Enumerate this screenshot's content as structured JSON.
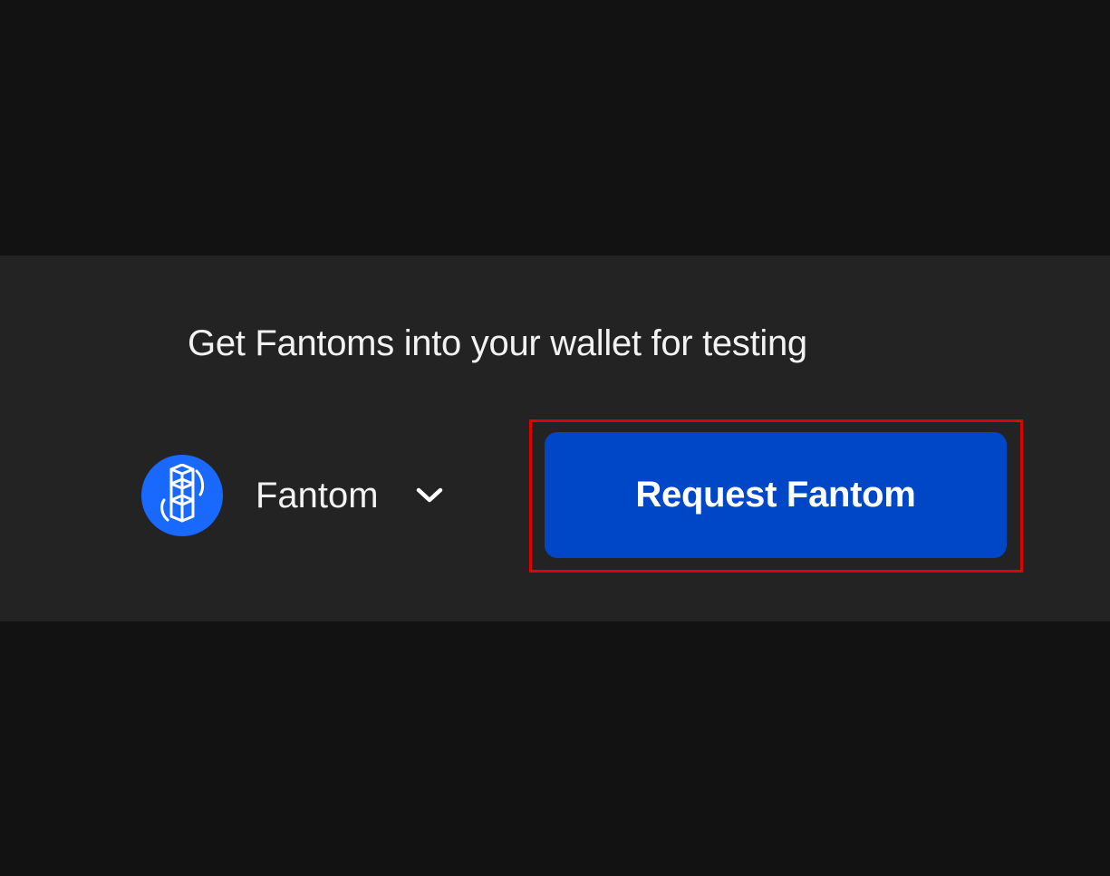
{
  "faucet": {
    "heading": "Get Fantoms into your wallet for testing",
    "network": {
      "name": "Fantom",
      "icon": "fantom-logo-icon",
      "dropdown_icon": "chevron-down-icon"
    },
    "request_button_label": "Request Fantom"
  },
  "colors": {
    "page_background": "#121212",
    "panel_background": "#232323",
    "button_background": "#0047C8",
    "logo_background": "#1969FF",
    "highlight_border": "#E00000",
    "text": "#F2F2F2"
  }
}
